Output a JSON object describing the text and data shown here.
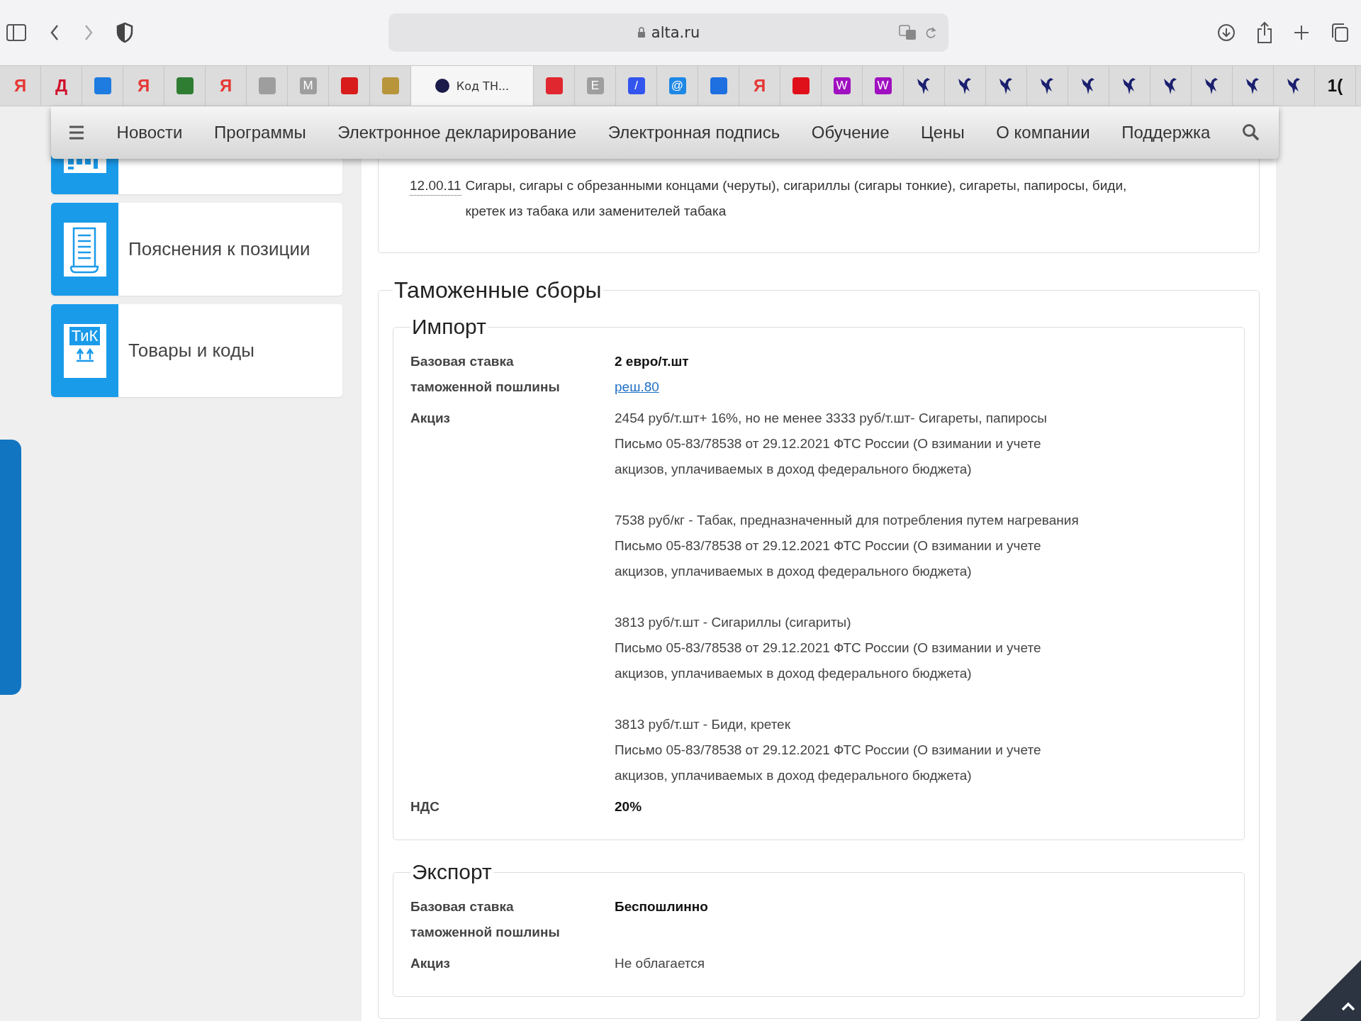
{
  "browser": {
    "address": "alta.ru"
  },
  "bookmarks": [
    {
      "kind": "text",
      "label": "Я",
      "color": "#e53935"
    },
    {
      "kind": "text",
      "label": "Д",
      "color": "#d0102a"
    },
    {
      "kind": "tile",
      "color": "#1e7be0"
    },
    {
      "kind": "text",
      "label": "Я",
      "color": "#e53935"
    },
    {
      "kind": "tile",
      "color": "#2e7d32"
    },
    {
      "kind": "text",
      "label": "Я",
      "color": "#e53935"
    },
    {
      "kind": "tile",
      "color": "#9e9e9e"
    },
    {
      "kind": "badge",
      "label": "M",
      "color": "#9e9e9e"
    },
    {
      "kind": "tile",
      "color": "#d81b1b"
    },
    {
      "kind": "tile",
      "color": "#b8953a"
    },
    {
      "kind": "tab",
      "label": "Код ТН..."
    },
    {
      "kind": "tile",
      "color": "#e0262e"
    },
    {
      "kind": "badge",
      "label": "E",
      "color": "#9e9e9e"
    },
    {
      "kind": "badge",
      "label": "/",
      "color": "#3355ee"
    },
    {
      "kind": "badge",
      "label": "@",
      "color": "#1e88e5"
    },
    {
      "kind": "tile",
      "color": "#1e6fe0"
    },
    {
      "kind": "text",
      "label": "Я",
      "color": "#e53935"
    },
    {
      "kind": "tile",
      "color": "#e0101a"
    },
    {
      "kind": "badge",
      "label": "W",
      "color": "#a010c0"
    },
    {
      "kind": "badge",
      "label": "W",
      "color": "#a010c0"
    },
    {
      "kind": "bird"
    },
    {
      "kind": "bird"
    },
    {
      "kind": "bird"
    },
    {
      "kind": "bird"
    },
    {
      "kind": "bird"
    },
    {
      "kind": "bird"
    },
    {
      "kind": "bird"
    },
    {
      "kind": "bird"
    },
    {
      "kind": "bird"
    },
    {
      "kind": "bird"
    },
    {
      "kind": "text",
      "label": "1(",
      "color": "#111111"
    }
  ],
  "nav": {
    "items": [
      "Новости",
      "Программы",
      "Электронное декларирование",
      "Электронная подпись",
      "Обучение",
      "Цены",
      "О компании",
      "Поддержка"
    ]
  },
  "sidebar": {
    "items": [
      {
        "kind": "calendar"
      },
      {
        "kind": "scroll",
        "label": "Пояснения к позиции"
      },
      {
        "kind": "goods",
        "label": "Товары и коды",
        "icon_text": "ТиК"
      }
    ]
  },
  "okpd": {
    "code": "12.00.11",
    "description": "Сигары, сигары с обрезанными концами (черуты), сигариллы (сигары тонкие), сигареты, папиросы, биди, кретек из табака или заменителей табака"
  },
  "fees": {
    "title": "Таможенные сборы",
    "sections": [
      {
        "title": "Импорт",
        "rows": [
          {
            "label": "Базовая ставка таможенной пошлины",
            "kind": "rate",
            "value": "2 евро/т.шт",
            "link": "реш.80"
          },
          {
            "label": "Акциз",
            "kind": "excise",
            "entries": [
              {
                "title": "2454 руб/т.шт+ 16%, но не менее 3333 руб/т.шт- Сигареты, папиросы",
                "note": "Письмо 05-83/78538 от 29.12.2021 ФТС России (О взимании и учете акцизов, уплачиваемых в доход федерального бюджета)"
              },
              {
                "title": "7538 руб/кг - Табак, предназначенный для потребления путем нагревания",
                "note": "Письмо 05-83/78538 от 29.12.2021 ФТС России (О взимании и учете акцизов, уплачиваемых в доход федерального бюджета)"
              },
              {
                "title": "3813 руб/т.шт - Сигариллы (сигариты)",
                "note": "Письмо 05-83/78538 от 29.12.2021 ФТС России (О взимании и учете акцизов, уплачиваемых в доход федерального бюджета)"
              },
              {
                "title": "3813 руб/т.шт - Биди, кретек",
                "note": "Письмо 05-83/78538 от 29.12.2021 ФТС России (О взимании и учете акцизов, уплачиваемых в доход федерального бюджета)"
              }
            ]
          },
          {
            "label": "НДС",
            "kind": "rate",
            "value": "20%"
          }
        ]
      },
      {
        "title": "Экспорт",
        "rows": [
          {
            "label": "Базовая ставка таможенной пошлины",
            "kind": "rate",
            "value": "Беспошлинно"
          },
          {
            "label": "Акциз",
            "kind": "plain",
            "value": "Не облагается"
          }
        ]
      }
    ]
  }
}
